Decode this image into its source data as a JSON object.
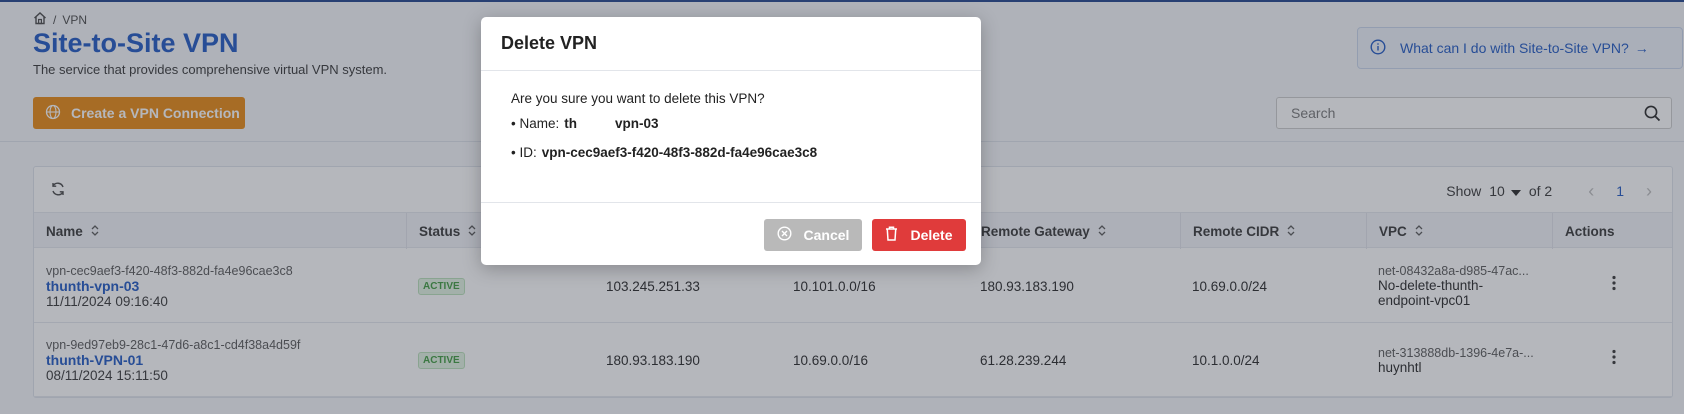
{
  "breadcrumb": {
    "separator": "/",
    "current": "VPN"
  },
  "page": {
    "title": "Site-to-Site VPN",
    "subtitle": "The service that provides comprehensive virtual VPN system.",
    "help_link": "What can I do with Site-to-Site VPN?",
    "help_arrow": "→"
  },
  "toolbar": {
    "create_label": "Create a VPN Connection",
    "search_placeholder": "Search"
  },
  "pager": {
    "show_label": "Show",
    "page_size": "10",
    "of_label": "of 2",
    "current_page": "1",
    "prev": "‹",
    "next": "›"
  },
  "table": {
    "columns": [
      "Name",
      "Status",
      "Remote Gateway",
      "Remote CIDR",
      "VPC",
      "Actions"
    ],
    "rows": [
      {
        "id": "vpn-cec9aef3-f420-48f3-882d-fa4e96cae3c8",
        "name": "thunth-vpn-03",
        "created": "11/11/2024 09:16:40",
        "status": "ACTIVE",
        "public_ip": "103.245.251.33",
        "local_cidr": "10.101.0.0/16",
        "remote_gateway": "180.93.183.190",
        "remote_cidr": "10.69.0.0/24",
        "vpc_id": "net-08432a8a-d985-47ac...",
        "vpc_name_1": "No-delete-thunth-",
        "vpc_name_2": "endpoint-vpc01"
      },
      {
        "id": "vpn-9ed97eb9-28c1-47d6-a8c1-cd4f38a4d59f",
        "name": "thunth-VPN-01",
        "created": "08/11/2024 15:11:50",
        "status": "ACTIVE",
        "public_ip": "180.93.183.190",
        "local_cidr": "10.69.0.0/16",
        "remote_gateway": "61.28.239.244",
        "remote_cidr": "10.1.0.0/24",
        "vpc_id": "net-313888db-1396-4e7a-...",
        "vpc_name_1": "huynhtl",
        "vpc_name_2": ""
      }
    ]
  },
  "modal": {
    "title": "Delete VPN",
    "question": "Are you sure you want to delete this VPN?",
    "name_label": "• Name:",
    "name_value_start": "th",
    "name_value_end": "vpn-03",
    "id_label": "• ID:",
    "id_value": "vpn-cec9aef3-f420-48f3-882d-fa4e96cae3c8",
    "cancel_label": "Cancel",
    "delete_label": "Delete"
  },
  "colors": {
    "brand": "#1b55c2",
    "primary_action": "#e8870c",
    "danger": "#e03b3b",
    "status_active": "#3a9a3a"
  }
}
